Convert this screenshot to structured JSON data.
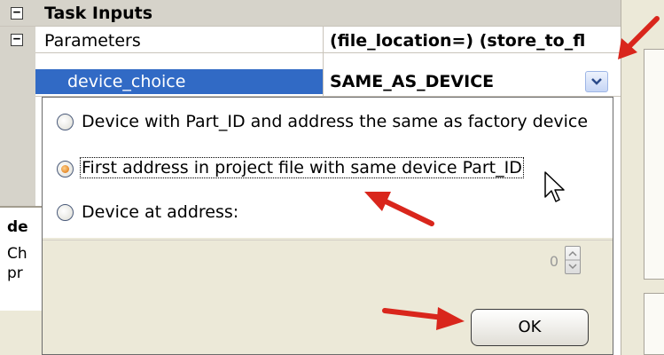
{
  "grid": {
    "category": {
      "expander": "⊟",
      "label": "Task Inputs"
    },
    "parameters": {
      "expander": "⊟",
      "label": "Parameters",
      "value": "(file_location=) (store_to_fl"
    },
    "device_choice": {
      "label": "device_choice",
      "value": "SAME_AS_DEVICE"
    }
  },
  "description": {
    "title": "de",
    "line1": "Ch",
    "line2": "pr"
  },
  "popup": {
    "options": [
      {
        "label": "Device with Part_ID and address the same as factory device",
        "selected": false
      },
      {
        "label": "First address in project file with same device Part_ID",
        "selected": true
      },
      {
        "label": "Device at address:",
        "selected": false
      }
    ],
    "spinner_value": "0",
    "ok_label": "OK"
  },
  "colors": {
    "selection": "#316ac5",
    "annotation_arrow": "#d9261c",
    "radio_selected": "#e07b00"
  },
  "icons": {
    "dropdown": "chevron-down-icon",
    "cursor": "mouse-pointer-icon",
    "annotation": "red-arrow-icon"
  }
}
